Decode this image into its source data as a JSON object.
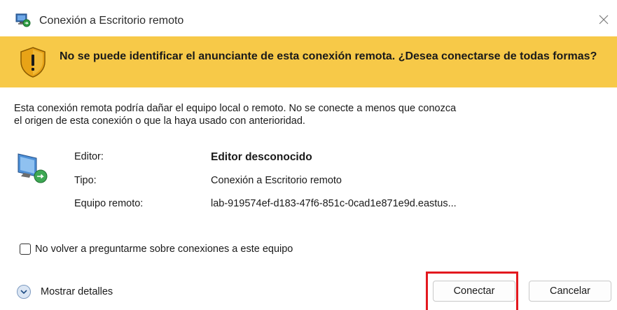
{
  "window": {
    "title": "Conexión a Escritorio remoto",
    "icon": "remote-desktop-icon",
    "close_icon": "close-icon"
  },
  "banner": {
    "background_color": "#f7c948",
    "icon": "warning-shield-icon",
    "message": "No se puede identificar el anunciante de esta conexión remota. ¿Desea conectarse de todas formas?"
  },
  "description": {
    "line1": "Esta conexión remota podría dañar el equipo local o remoto. No se conecte a menos que conozca",
    "line2": "el origen de esta conexión o que la haya usado con anterioridad."
  },
  "info": {
    "icon": "remote-computer-icon",
    "rows": [
      {
        "label": "Editor:",
        "value": "Editor desconocido"
      },
      {
        "label": "Tipo:",
        "value": "Conexión a Escritorio remoto"
      },
      {
        "label": "Equipo remoto:",
        "value": "lab-919574ef-d183-47f6-851c-0cad1e871e9d.eastus..."
      }
    ]
  },
  "checkbox": {
    "label": "No volver a preguntarme sobre conexiones a este equipo",
    "checked": false
  },
  "footer": {
    "details_label": "Mostrar detalles",
    "connect_label": "Conectar",
    "cancel_label": "Cancelar",
    "highlight_color": "#e3191f"
  }
}
